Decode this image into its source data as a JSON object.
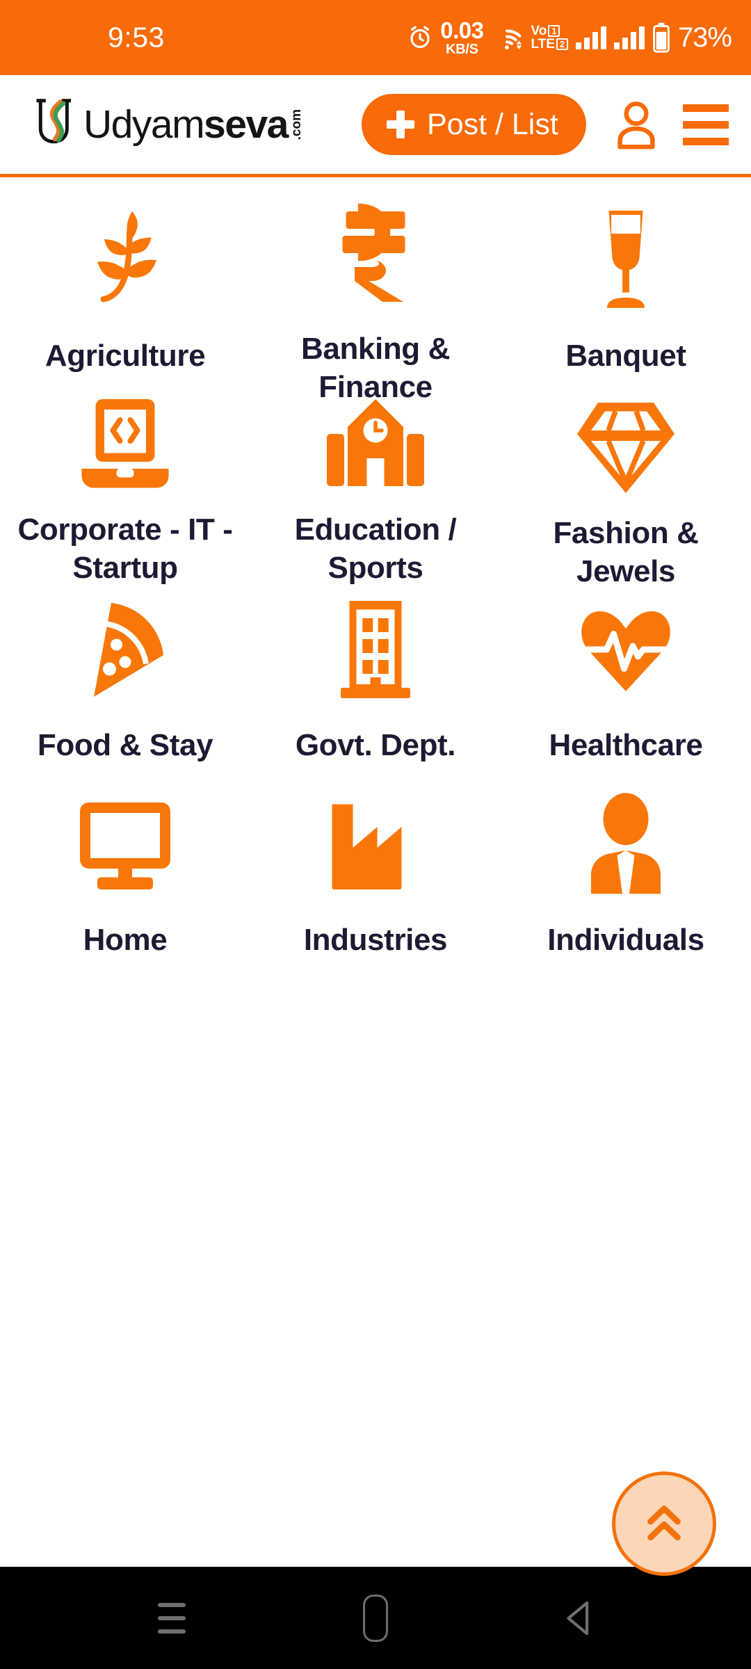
{
  "status_bar": {
    "time": "9:53",
    "network_speed_value": "0.03",
    "network_speed_unit": "KB/S",
    "alarm_icon": "alarm-clock-icon",
    "wifi_icon": "wifi-icon",
    "volte_line1": "Vo",
    "volte_line2": "LTE",
    "sim1_label": "1",
    "sim2_label": "2",
    "signal_icon": "signal-bars-icon",
    "battery_icon": "battery-icon",
    "battery_percent": "73%",
    "background_color": "#F96A08"
  },
  "header": {
    "logo_mark": "udyamseva-logo-icon",
    "logo_word1": "Udyam",
    "logo_word2": "seva",
    "logo_tld": ".com",
    "post_button_label": "Post / List",
    "post_button_icon": "plus-icon",
    "account_icon": "user-account-icon",
    "menu_icon": "hamburger-menu-icon",
    "accent_color": "#F96A08"
  },
  "categories": [
    {
      "label": "Agriculture",
      "icon": "leaf-branch-icon"
    },
    {
      "label": "Banking & Finance",
      "icon": "rupee-icon"
    },
    {
      "label": "Banquet",
      "icon": "wine-glass-icon"
    },
    {
      "label": "Corporate - IT - Startup",
      "icon": "laptop-code-icon"
    },
    {
      "label": "Education / Sports",
      "icon": "school-building-icon"
    },
    {
      "label": "Fashion & Jewels",
      "icon": "diamond-icon"
    },
    {
      "label": "Food & Stay",
      "icon": "pizza-slice-icon"
    },
    {
      "label": "Govt. Dept.",
      "icon": "office-building-icon"
    },
    {
      "label": "Healthcare",
      "icon": "heart-pulse-icon"
    },
    {
      "label": "Home",
      "icon": "monitor-icon"
    },
    {
      "label": "Industries",
      "icon": "factory-icon"
    },
    {
      "label": "Individuals",
      "icon": "person-suit-icon"
    }
  ],
  "scroll_top_button": {
    "icon": "double-chevron-up-icon",
    "fill_color": "#FBD6B7",
    "border_color": "#F2720C"
  },
  "android_nav": {
    "recents_icon": "recent-apps-icon",
    "home_icon": "home-pill-icon",
    "back_icon": "back-triangle-icon"
  }
}
